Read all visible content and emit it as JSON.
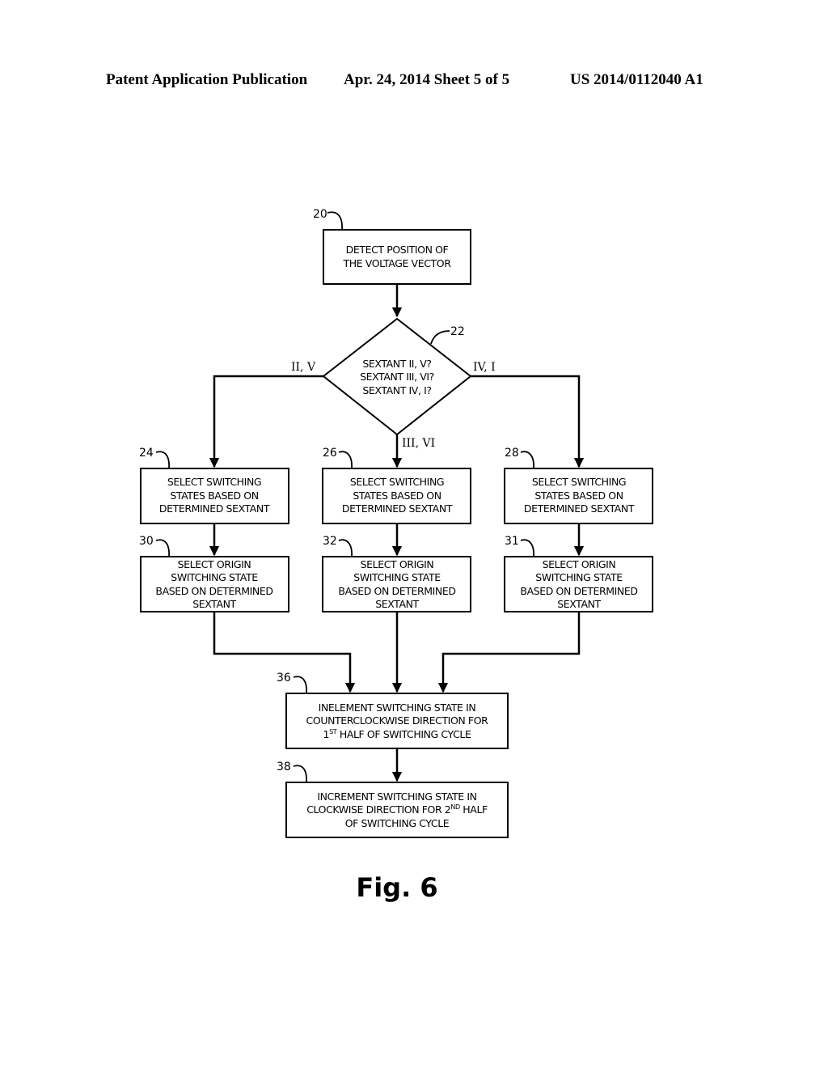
{
  "header": {
    "publication": "Patent Application Publication",
    "date_sheet": "Apr. 24, 2014  Sheet 5 of 5",
    "number": "US 2014/0112040 A1"
  },
  "figure_label": "Fig. 6",
  "nodes": {
    "detect": {
      "ref": "20",
      "lines": [
        "DETECT POSITION OF",
        "THE VOLTAGE VECTOR"
      ]
    },
    "decision": {
      "ref": "22",
      "lines": [
        "SEXTANT II, V?",
        "SEXTANT III, VI?",
        "SEXTANT IV, I?"
      ]
    },
    "select_states_left": {
      "ref": "24",
      "lines": [
        "SELECT SWITCHING",
        "STATES BASED ON",
        "DETERMINED SEXTANT"
      ]
    },
    "select_states_center": {
      "ref": "26",
      "lines": [
        "SELECT SWITCHING",
        "STATES BASED ON",
        "DETERMINED SEXTANT"
      ]
    },
    "select_states_right": {
      "ref": "28",
      "lines": [
        "SELECT SWITCHING",
        "STATES BASED ON",
        "DETERMINED SEXTANT"
      ]
    },
    "select_origin_left": {
      "ref": "30",
      "lines": [
        "SELECT ORIGIN",
        "SWITCHING STATE",
        "BASED ON DETERMINED",
        "SEXTANT"
      ]
    },
    "select_origin_center": {
      "ref": "32",
      "lines": [
        "SELECT ORIGIN",
        "SWITCHING STATE",
        "BASED ON DETERMINED",
        "SEXTANT"
      ]
    },
    "select_origin_right": {
      "ref": "31",
      "lines": [
        "SELECT ORIGIN",
        "SWITCHING STATE",
        "BASED ON DETERMINED",
        "SEXTANT"
      ]
    },
    "increment_ccw": {
      "ref": "36",
      "line1": "INELEMENT SWITCHING STATE IN",
      "line2": "COUNTERCLOCKWISE DIRECTION FOR",
      "line3_pre": "1",
      "line3_sup": "ST",
      "line3_post": " HALF OF SWITCHING CYCLE"
    },
    "increment_cw": {
      "ref": "38",
      "line1": "INCREMENT SWITCHING STATE IN",
      "line2_pre": "CLOCKWISE DIRECTION FOR 2",
      "line2_sup": "ND",
      "line2_post": " HALF",
      "line3": "OF SWITCHING CYCLE"
    }
  },
  "branches": {
    "left": "II, V",
    "right": "IV, I",
    "down": "III, VI"
  }
}
